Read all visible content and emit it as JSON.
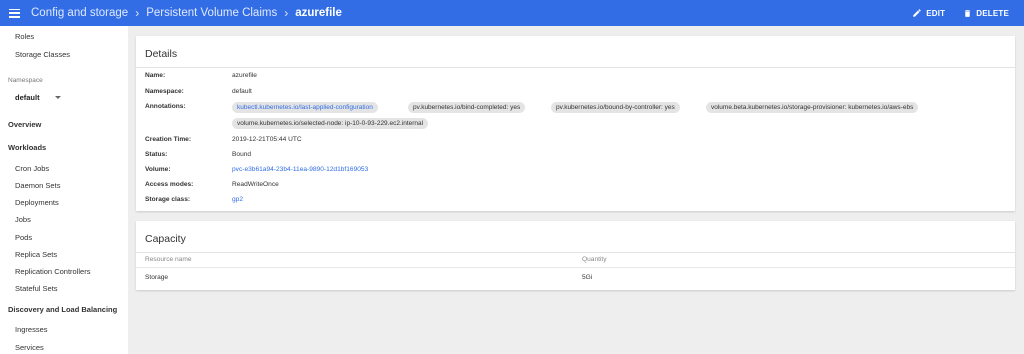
{
  "topbar": {
    "breadcrumbs": [
      "Config and storage",
      "Persistent Volume Claims",
      "azurefile"
    ],
    "edit_label": "EDIT",
    "delete_label": "DELETE",
    "bg_color": "#326de6"
  },
  "sidebar": {
    "items_top": [
      "Roles",
      "Storage Classes"
    ],
    "namespace_label": "Namespace",
    "namespace_value": "default",
    "overview": "Overview",
    "workloads_heading": "Workloads",
    "workloads": [
      "Cron Jobs",
      "Daemon Sets",
      "Deployments",
      "Jobs",
      "Pods",
      "Replica Sets",
      "Replication Controllers",
      "Stateful Sets"
    ],
    "discovery_heading": "Discovery and Load Balancing",
    "discovery": [
      "Ingresses",
      "Services"
    ]
  },
  "details": {
    "title": "Details",
    "labels": {
      "name": "Name:",
      "namespace": "Namespace:",
      "annotations": "Annotations:",
      "creation_time": "Creation Time:",
      "status": "Status:",
      "volume": "Volume:",
      "access_modes": "Access modes:",
      "storage_class": "Storage class:"
    },
    "values": {
      "name": "azurefile",
      "namespace": "default",
      "creation_time": "2019-12-21T05:44 UTC",
      "status": "Bound",
      "volume": "pvc-e3b61a94-23b4-11ea-9890-12d1bf169053",
      "access_modes": "ReadWriteOnce",
      "storage_class": "gp2"
    },
    "annotations": [
      "kubectl.kubernetes.io/last-applied-configuration",
      "pv.kubernetes.io/bind-completed:  yes",
      "pv.kubernetes.io/bound-by-controller:  yes",
      "volume.beta.kubernetes.io/storage-provisioner:  kubernetes.io/aws-ebs",
      "volume.kubernetes.io/selected-node:  ip-10-0-93-229.ec2.internal"
    ]
  },
  "capacity": {
    "title": "Capacity",
    "headers": [
      "Resource name",
      "Quantity"
    ],
    "rows": [
      [
        "Storage",
        "5Gi"
      ]
    ]
  }
}
